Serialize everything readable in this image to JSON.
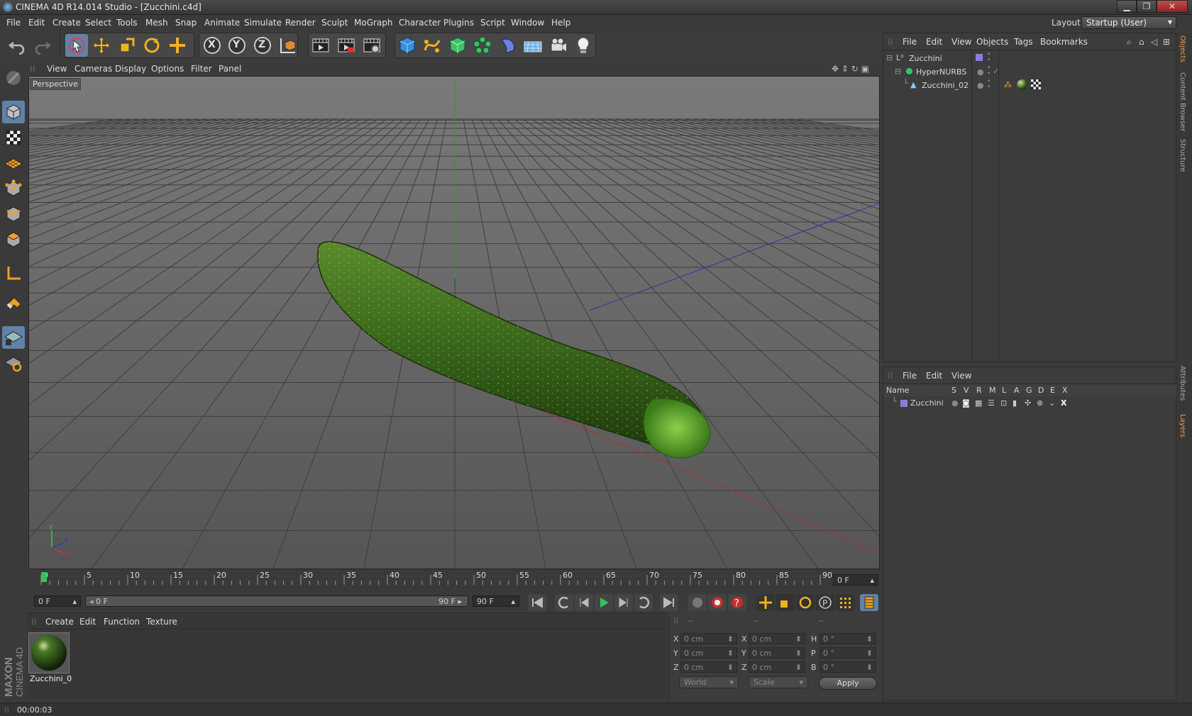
{
  "window": {
    "title": "CINEMA 4D R14.014 Studio - [Zucchini.c4d]",
    "minimize": "▁",
    "maximize": "❐",
    "close": "✕"
  },
  "menu": [
    "File",
    "Edit",
    "Create",
    "Select",
    "Tools",
    "Mesh",
    "Snap",
    "Animate",
    "Simulate",
    "Render",
    "Sculpt",
    "MoGraph",
    "Character",
    "Plugins",
    "Script",
    "Window",
    "Help"
  ],
  "layout": {
    "label": "Layout:",
    "value": "Startup (User)"
  },
  "toolbar": {
    "axis_x": "X",
    "axis_y": "Y",
    "axis_z": "Z",
    "icons": [
      "undo-icon",
      "redo-icon",
      "live-select-icon",
      "move-icon",
      "scale-icon",
      "rotate-icon",
      "create-object-icon",
      "lock-x-icon",
      "lock-y-icon",
      "lock-z-icon",
      "coordinate-system-icon",
      "render-view-icon",
      "render-picture-viewer-icon",
      "render-settings-icon",
      "cube-icon",
      "spline-icon",
      "nurbs-icon",
      "array-icon",
      "deformer-icon",
      "floor-icon",
      "camera-icon",
      "light-icon"
    ]
  },
  "viewport": {
    "menu": [
      "View",
      "Cameras",
      "Display",
      "Options",
      "Filter",
      "Panel"
    ],
    "label": "Perspective",
    "axis_y": "y",
    "axis_x": "x",
    "axis_z": "z"
  },
  "timeline": {
    "ticks": [
      "0",
      "5",
      "10",
      "15",
      "20",
      "25",
      "30",
      "35",
      "40",
      "45",
      "50",
      "55",
      "60",
      "65",
      "70",
      "75",
      "80",
      "85",
      "90"
    ],
    "current_frame": "0 F",
    "start_frame": "0 F",
    "range_start": "0 F",
    "range_end": "90 F",
    "end_frame": "90 F",
    "playhead_fraction": 0.0
  },
  "material_manager": {
    "menu": [
      "Create",
      "Edit",
      "Function",
      "Texture"
    ],
    "material_name": "Zucchini_0"
  },
  "coordinates": {
    "header": [
      "--",
      "--",
      "--"
    ],
    "rows": [
      {
        "pos_label": "X",
        "pos": "0 cm",
        "size_label": "X",
        "size": "0 cm",
        "rot_label": "H",
        "rot": "0 °"
      },
      {
        "pos_label": "Y",
        "pos": "0 cm",
        "size_label": "Y",
        "size": "0 cm",
        "rot_label": "P",
        "rot": "0 °"
      },
      {
        "pos_label": "Z",
        "pos": "0 cm",
        "size_label": "Z",
        "size": "0 cm",
        "rot_label": "B",
        "rot": "0 °"
      }
    ],
    "space": "World",
    "mode": "Scale",
    "apply": "Apply"
  },
  "object_manager": {
    "menu": [
      "File",
      "Edit",
      "View",
      "Objects",
      "Tags",
      "Bookmarks"
    ],
    "objects": [
      {
        "name": "Zucchini",
        "indent": 0,
        "icon": "null-object-icon"
      },
      {
        "name": "HyperNURBS",
        "indent": 1,
        "icon": "hypernurbs-icon",
        "check": "✓"
      },
      {
        "name": "Zucchini_02",
        "indent": 2,
        "icon": "polygon-object-icon"
      }
    ]
  },
  "layer_manager": {
    "menu": [
      "File",
      "Edit",
      "View"
    ],
    "columns": [
      "Name",
      "S",
      "V",
      "R",
      "M",
      "L",
      "A",
      "G",
      "D",
      "E",
      "X"
    ],
    "layers": [
      {
        "name": "Zucchini",
        "color": "#8a7cdc",
        "last": "X"
      }
    ]
  },
  "right_tabs": [
    "Objects",
    "Content Browser",
    "Structure",
    "Attributes",
    "Layers"
  ],
  "status": {
    "time": "00:00:03"
  },
  "colors": {
    "accent": "#5f82a8",
    "bg": "#3c3c3c",
    "zucchini": "#3e6a1e",
    "x_axis": "#c33",
    "y_axis": "#3c3",
    "z_axis": "#33c"
  }
}
